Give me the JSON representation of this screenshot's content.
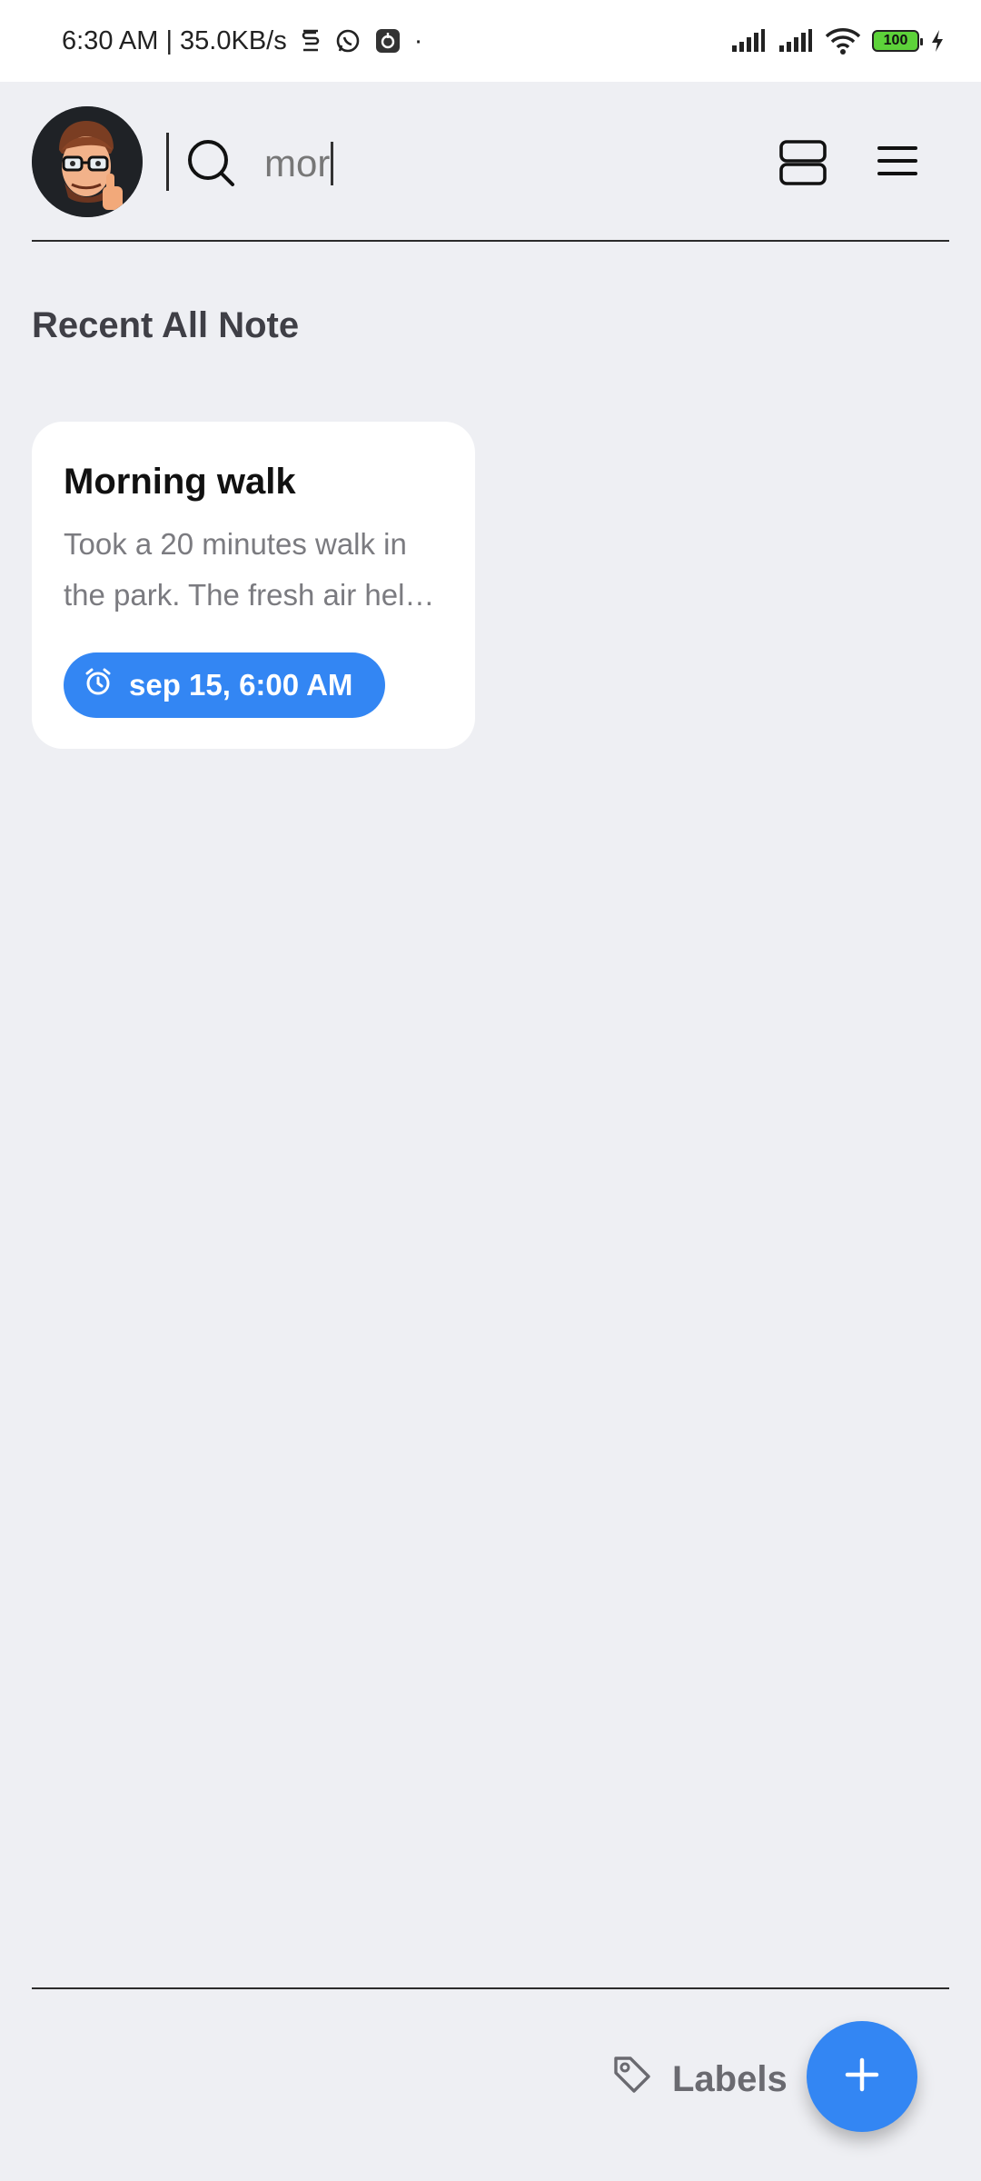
{
  "statusbar": {
    "time_speed": "6:30 AM | 35.0KB/s",
    "dot": "·",
    "battery": "100",
    "icons": [
      "notification-s-icon",
      "whatsapp-icon",
      "app-icon",
      "signal-icon",
      "signal-icon",
      "wifi-icon",
      "battery-icon",
      "charging-icon"
    ]
  },
  "header": {
    "search_value": "mor",
    "icons": [
      "avatar",
      "search-icon",
      "view-toggle-icon",
      "menu-icon"
    ]
  },
  "main": {
    "section_title": "Recent All Note",
    "notes": [
      {
        "title": "Morning walk",
        "body": "Took a 20 minutes walk in the park. The fresh air hel…",
        "reminder": "sep 15, 6:00 AM"
      }
    ]
  },
  "footer": {
    "labels_label": "Labels",
    "fab_icon": "plus-icon"
  },
  "colors": {
    "accent": "#3386f3",
    "background": "#eeeff3",
    "card": "#ffffff"
  }
}
